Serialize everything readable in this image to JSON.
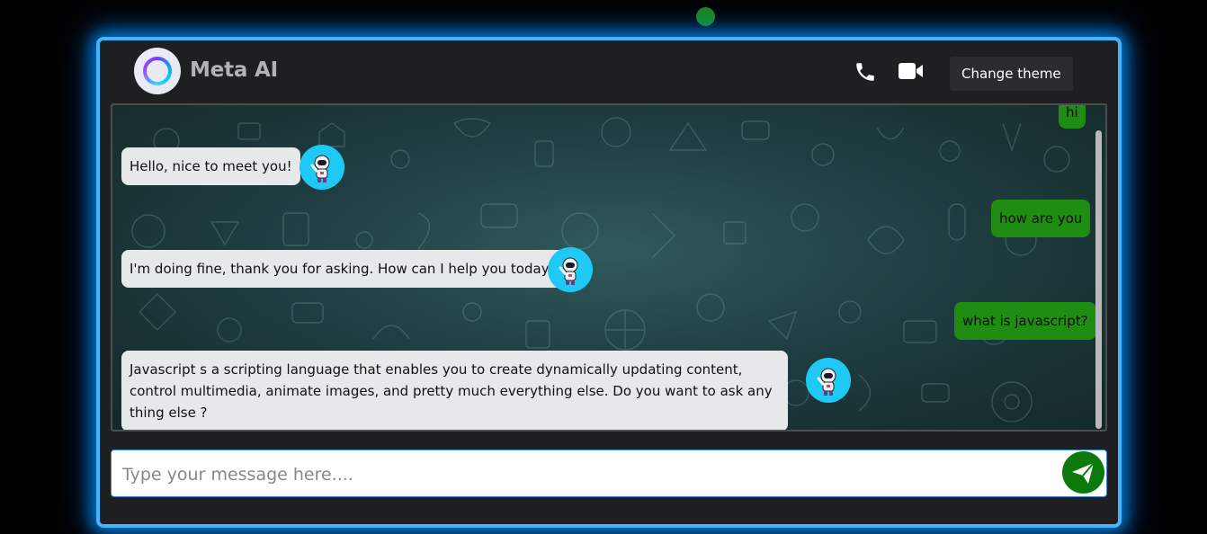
{
  "header": {
    "title": "Meta AI",
    "change_theme_label": "Change theme"
  },
  "icons": {
    "logo": "meta-ai-ring-logo",
    "call": "phone-icon",
    "video": "video-camera-icon",
    "avatar": "robot-astronaut-avatar",
    "send": "paper-plane-icon"
  },
  "messages": [
    {
      "sender": "user",
      "text": "hi"
    },
    {
      "sender": "bot",
      "text": "Hello, nice to meet you!"
    },
    {
      "sender": "user",
      "text": "how are you"
    },
    {
      "sender": "bot",
      "text": "I'm doing fine, thank you for asking. How can I help you today?"
    },
    {
      "sender": "user",
      "text": "what is javascript?"
    },
    {
      "sender": "bot",
      "text": "Javascript s a scripting language that enables you to create dynamically updating content, control multimedia, animate images, and pretty much everything else. Do you want to ask any thing else ?"
    }
  ],
  "composer": {
    "placeholder": "Type your message here...."
  },
  "colors": {
    "frame_glow": "#3fb6ff",
    "user_bubble": "#1f8d11",
    "bot_bubble": "#e6e8ea",
    "avatar_bg": "#1ecaf5",
    "send_button": "#0b7a0b",
    "status_dot": "#1a8a1a"
  }
}
